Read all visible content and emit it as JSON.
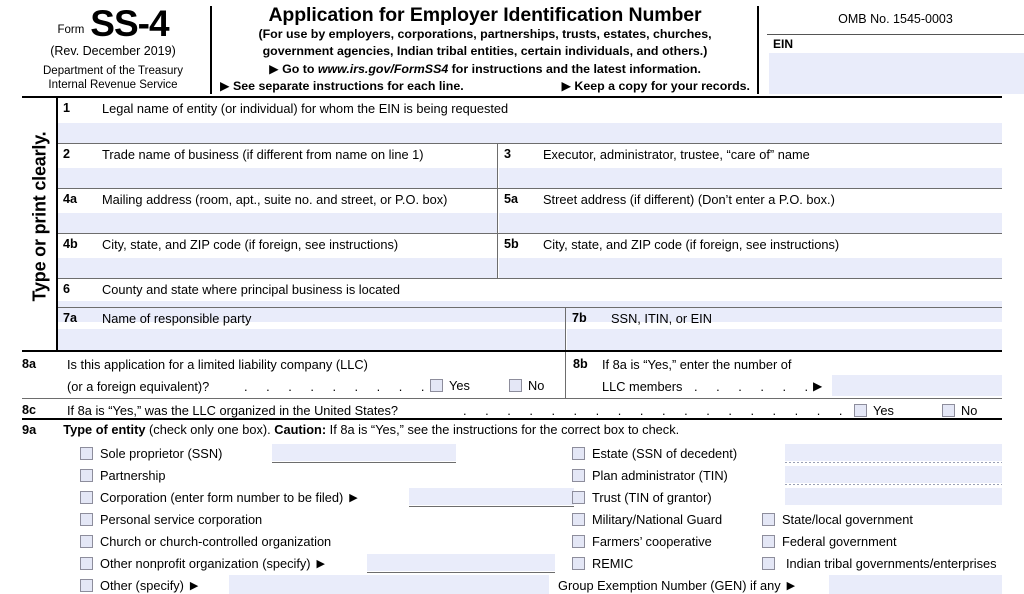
{
  "header": {
    "form_label": "Form",
    "form_number": "SS-4",
    "revision": "(Rev. December 2019)",
    "department_line1": "Department of the Treasury",
    "department_line2": "Internal Revenue Service",
    "title": "Application for Employer Identification Number",
    "subtitle_line1": "(For use by employers, corporations, partnerships, trusts, estates, churches,",
    "subtitle_line2": "government agencies, Indian tribal entities, certain individuals, and others.)",
    "goto_prefix": "▶ Go to ",
    "goto_url": "www.irs.gov/FormSS4",
    "goto_suffix": " for instructions and the latest information.",
    "see_instructions": "▶ See separate instructions for each line.",
    "keep_copy": "▶ Keep a copy for your records.",
    "omb": "OMB No. 1545-0003",
    "ein_label": "EIN",
    "ein_value": ""
  },
  "side_label": "Type or print clearly.",
  "lines": [
    {
      "num": "1",
      "caption": "Legal name of entity (or individual) for whom the EIN is being requested",
      "value": ""
    },
    {
      "num": "2",
      "caption": "Trade name of business (if different from name on line 1)",
      "value": ""
    },
    {
      "num": "3",
      "caption": "Executor, administrator, trustee, “care of” name",
      "value": ""
    },
    {
      "num": "4a",
      "caption": "Mailing address (room, apt., suite no. and street, or P.O. box)",
      "value": ""
    },
    {
      "num": "5a",
      "caption": "Street address (if different) (Don’t enter a P.O. box.)",
      "value": ""
    },
    {
      "num": "4b",
      "caption": "City, state, and ZIP code (if foreign, see instructions)",
      "value": ""
    },
    {
      "num": "5b",
      "caption": "City, state, and ZIP code (if foreign, see instructions)",
      "value": ""
    },
    {
      "num": "6",
      "caption": "County and state where principal business is located",
      "value": ""
    },
    {
      "num": "7a",
      "caption": "Name of responsible party",
      "value": ""
    },
    {
      "num": "7b",
      "caption": "SSN, ITIN, or EIN",
      "value": ""
    }
  ],
  "line8a": {
    "num": "8a",
    "text_line1": "Is this application for a limited liability company (LLC)",
    "text_line2": "(or a foreign equivalent)?",
    "leader": ". . . . . . . . .",
    "yes_label": "Yes",
    "no_label": "No"
  },
  "line8b": {
    "num": "8b",
    "text_line1": "If 8a is “Yes,” enter  the  number  of",
    "text_line2": "LLC members",
    "leader": ". . . . . .",
    "arrow": "▶",
    "value": ""
  },
  "line8c": {
    "num": "8c",
    "text": "If 8a is “Yes,” was the LLC organized in the United States?",
    "leader": ". . . . . . . . . . . . . . . . . .",
    "yes_label": "Yes",
    "no_label": "No"
  },
  "line9a": {
    "num": "9a",
    "heading_bold": "Type of entity",
    "heading_mid": " (check only one box). ",
    "heading_caution": "Caution:",
    "heading_tail": " If 8a is “Yes,” see the instructions for the correct box to check.",
    "col1": [
      {
        "label": "Sole proprietor (SSN)",
        "has_field": true,
        "arrow": false,
        "value": ""
      },
      {
        "label": "Partnership",
        "has_field": false,
        "arrow": false,
        "value": ""
      },
      {
        "label": "Corporation (enter form number to be filed)",
        "has_field": true,
        "arrow": true,
        "value": ""
      },
      {
        "label": "Personal service corporation",
        "has_field": false,
        "arrow": false,
        "value": ""
      },
      {
        "label": "Church or church-controlled organization",
        "has_field": false,
        "arrow": false,
        "value": ""
      },
      {
        "label": "Other nonprofit organization (specify)",
        "has_field": true,
        "arrow": true,
        "value": ""
      },
      {
        "label": "Other (specify)",
        "has_field": true,
        "arrow": true,
        "value": ""
      }
    ],
    "col2": [
      {
        "label": "Estate (SSN of decedent)",
        "has_field": true,
        "value": ""
      },
      {
        "label": "Plan administrator (TIN)",
        "has_field": true,
        "value": ""
      },
      {
        "label": "Trust (TIN of grantor)",
        "has_field": true,
        "value": ""
      },
      {
        "label": "Military/National Guard",
        "has_field": false,
        "value": ""
      },
      {
        "label": "Farmers’ cooperative",
        "has_field": false,
        "value": ""
      },
      {
        "label": "REMIC",
        "has_field": false,
        "value": ""
      }
    ],
    "col3": [
      {
        "label": "State/local government"
      },
      {
        "label": "Federal government"
      },
      {
        "label": "Indian tribal governments/enterprises"
      }
    ],
    "gen_label": "Group Exemption Number (GEN) if any",
    "gen_arrow": "▶",
    "gen_value": ""
  },
  "colors": {
    "field_fill": "#e9ecfa",
    "checkbox_fill": "#e4e7f6",
    "checkbox_border": "#8d8d9c",
    "rule": "#000000",
    "thin_rule": "#6d6d6d"
  }
}
